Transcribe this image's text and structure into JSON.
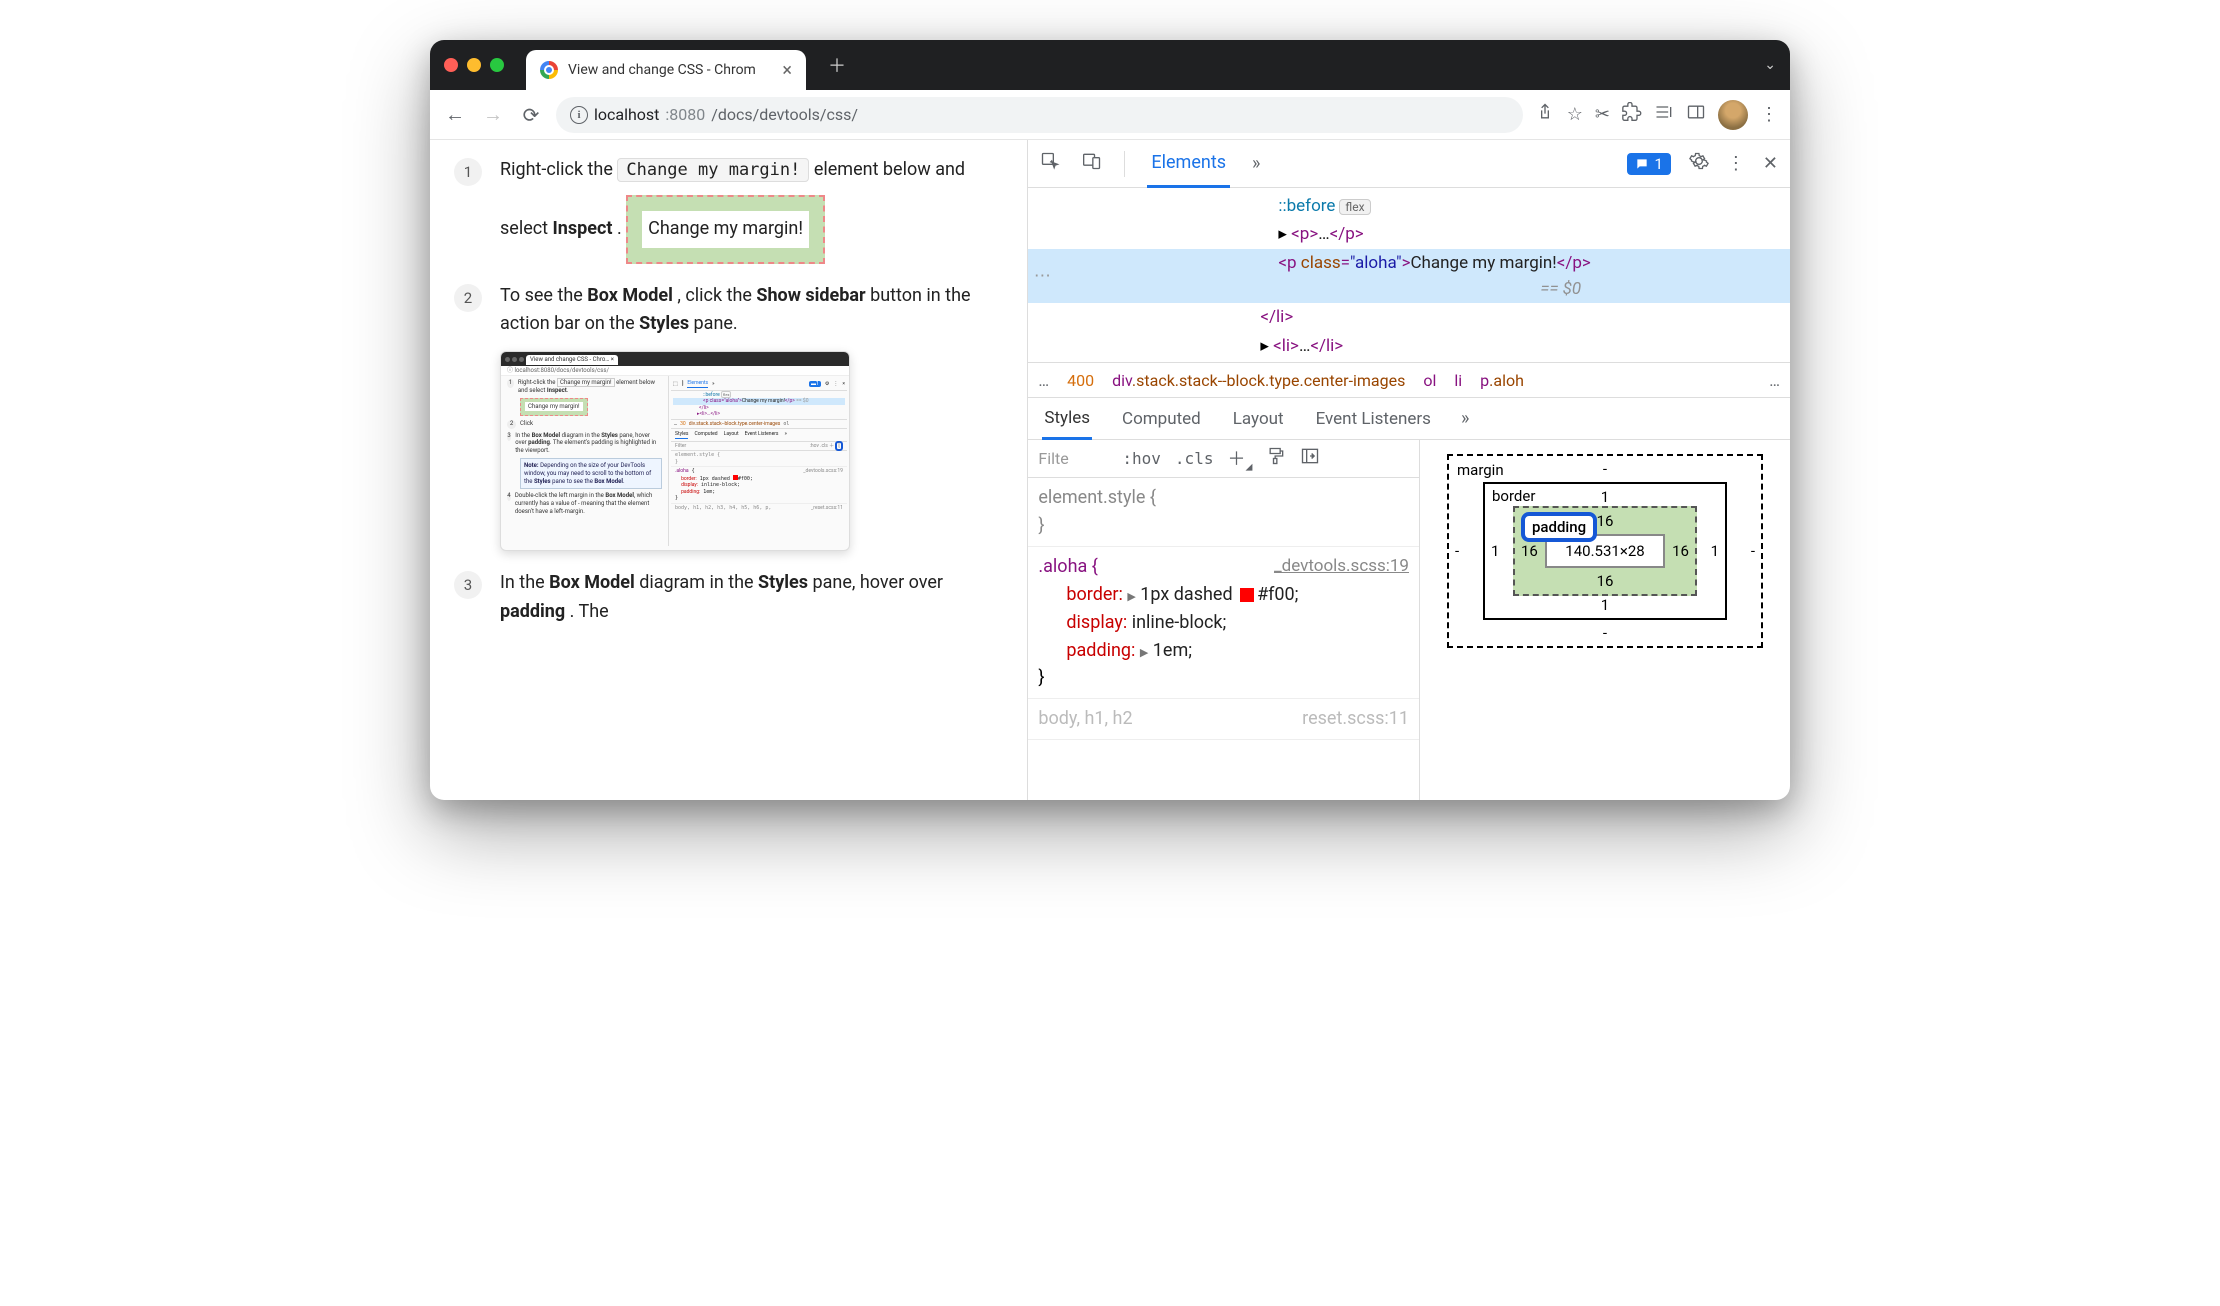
{
  "browser": {
    "tab_title": "View and change CSS - Chrom",
    "url": {
      "host": "localhost",
      "port": ":8080",
      "path": "/docs/devtools/css/"
    }
  },
  "page": {
    "step1_a": "Right-click the ",
    "step1_code": "Change my margin!",
    "step1_b": " element below and select ",
    "step1_bold": "Inspect",
    "step1_c": ".",
    "demo_text": "Change my margin!",
    "step2_a": "To see the ",
    "step2_b1": "Box Model",
    "step2_c": ", click the ",
    "step2_b2": "Show sidebar",
    "step2_d": " button in the action bar on the ",
    "step2_b3": "Styles",
    "step2_e": " pane.",
    "step3_a": "In the ",
    "step3_b1": "Box Model",
    "step3_b": " diagram in the ",
    "step3_b2": "Styles",
    "step3_c": " pane, hover over ",
    "step3_b3": "padding",
    "step3_d": ". The"
  },
  "devtools": {
    "tabs": {
      "elements": "Elements"
    },
    "issues_count": "1",
    "dom": {
      "before": "::before",
      "flex": "flex",
      "p_collapsed": "<p>…</p>",
      "sel_open": "<p class=\"aloha\">",
      "sel_text": "Change my margin!",
      "sel_close": "</p>",
      "eq": "== $0",
      "li_close": "</li>",
      "li_next": "<li>…</li>"
    },
    "crumbs": {
      "dots": "…",
      "num": "400",
      "path": "div.stack.stack--block.type.center-images",
      "ol": "ol",
      "li": "li",
      "p": "p.aloh",
      "more": "…"
    },
    "subtabs": {
      "styles": "Styles",
      "computed": "Computed",
      "layout": "Layout",
      "event": "Event Listeners"
    },
    "filter": {
      "placeholder": "Filte",
      "hov": ":hov",
      "cls": ".cls"
    },
    "rules": {
      "element": "element.style {",
      "close": "}",
      "aloha_sel": ".aloha {",
      "aloha_src": "_devtools.scss:19",
      "border_p": "border:",
      "border_v": "1px dashed ",
      "border_hex": "#f00;",
      "display_p": "display:",
      "display_v": "inline-block;",
      "padding_p": "padding:",
      "padding_v": "1em;",
      "body_sel": "body, h1, h2",
      "body_src": "reset.scss:11"
    },
    "box": {
      "margin_label": "margin",
      "border_label": "border",
      "padding_label": "padding",
      "content": "140.531×28",
      "margin": {
        "t": "-",
        "r": "-",
        "b": "-",
        "l": "-"
      },
      "border": {
        "t": "1",
        "r": "1",
        "b": "1",
        "l": "1"
      },
      "padding": {
        "t": "16",
        "r": "16",
        "b": "16",
        "l": "16"
      }
    }
  }
}
